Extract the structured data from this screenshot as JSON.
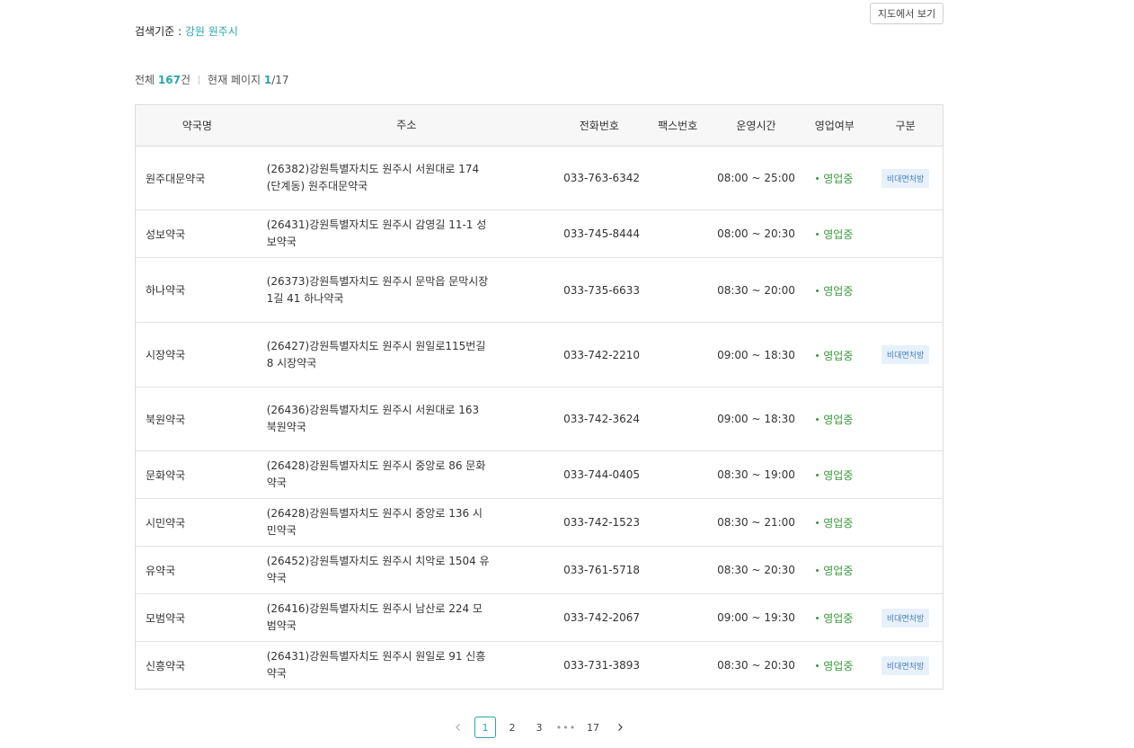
{
  "top": {
    "map_button": "지도에서 보기",
    "search_label": "검색기준 :",
    "search_region": "강원 원주시"
  },
  "summary": {
    "total_label": "전체",
    "total_count": "167",
    "total_unit": "건",
    "page_label": "현재 페이지",
    "current_page": "1",
    "total_pages": "/17"
  },
  "table": {
    "headers": {
      "name": "약국명",
      "address": "주소",
      "tel": "전화번호",
      "fax": "팩스번호",
      "hours": "운영시간",
      "status": "영업여부",
      "type": "구분"
    },
    "rows": [
      {
        "name": "원주대문약국",
        "address": "(26382)강원특별자치도 원주시 서원대로 174 (단계동) 원주대문약국",
        "tel": "033-763-6342",
        "fax": "",
        "hours": "08:00 ~ 25:00",
        "status": "영업중",
        "type": "비대면처방"
      },
      {
        "name": "성보약국",
        "address": "(26431)강원특별자치도 원주시 감영길 11-1 성보약국",
        "tel": "033-745-8444",
        "fax": "",
        "hours": "08:00 ~ 20:30",
        "status": "영업중",
        "type": ""
      },
      {
        "name": "하나약국",
        "address": "(26373)강원특별자치도 원주시 문막읍 문막시장1길 41 하나약국",
        "tel": "033-735-6633",
        "fax": "",
        "hours": "08:30 ~ 20:00",
        "status": "영업중",
        "type": ""
      },
      {
        "name": "시장약국",
        "address": "(26427)강원특별자치도 원주시 원일로115번길 8 시장약국",
        "tel": "033-742-2210",
        "fax": "",
        "hours": "09:00 ~ 18:30",
        "status": "영업중",
        "type": "비대면처방"
      },
      {
        "name": "북원약국",
        "address": "(26436)강원특별자치도 원주시 서원대로 163 북원약국",
        "tel": "033-742-3624",
        "fax": "",
        "hours": "09:00 ~ 18:30",
        "status": "영업중",
        "type": ""
      },
      {
        "name": "문화약국",
        "address": "(26428)강원특별자치도 원주시 중앙로 86 문화약국",
        "tel": "033-744-0405",
        "fax": "",
        "hours": "08:30 ~ 19:00",
        "status": "영업중",
        "type": ""
      },
      {
        "name": "시민약국",
        "address": "(26428)강원특별자치도 원주시 중앙로 136 시민약국",
        "tel": "033-742-1523",
        "fax": "",
        "hours": "08:30 ~ 21:00",
        "status": "영업중",
        "type": ""
      },
      {
        "name": "유약국",
        "address": "(26452)강원특별자치도 원주시 치악로 1504 유약국",
        "tel": "033-761-5718",
        "fax": "",
        "hours": "08:30 ~ 20:30",
        "status": "영업중",
        "type": ""
      },
      {
        "name": "모범약국",
        "address": "(26416)강원특별자치도 원주시 남산로 224 모범약국",
        "tel": "033-742-2067",
        "fax": "",
        "hours": "09:00 ~ 19:30",
        "status": "영업중",
        "type": "비대면처방"
      },
      {
        "name": "신흥약국",
        "address": "(26431)강원특별자치도 원주시 원일로 91 신흥약국",
        "tel": "033-731-3893",
        "fax": "",
        "hours": "08:30 ~ 20:30",
        "status": "영업중",
        "type": "비대면처방"
      }
    ]
  },
  "pagination": {
    "prev_icon": "chevron-left-icon",
    "pages": [
      "1",
      "2",
      "3"
    ],
    "ellipsis": "•••",
    "last_page": "17",
    "next_icon": "chevron-right-icon",
    "active_page": "1"
  },
  "colors": {
    "accent": "#2aa5a8",
    "open_status": "#3a9a3a",
    "badge_bg": "#e7f1fb",
    "badge_text": "#4a7fb5"
  }
}
